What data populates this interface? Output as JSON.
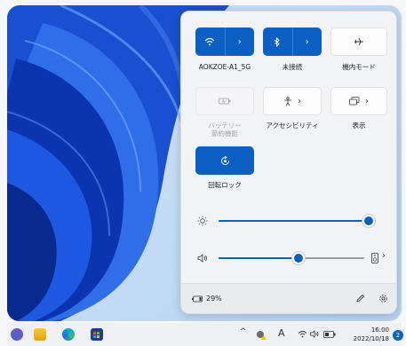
{
  "quick_settings": {
    "tiles": {
      "wifi_label": "AOKZOE-A1_5G",
      "bluetooth_label": "未接続",
      "airplane_label": "機内モード",
      "battery_saver_label": "バッテリー\n節約機能",
      "accessibility_label": "アクセシビリティ",
      "display_label": "表示",
      "rotation_lock_label": "回転ロック"
    },
    "brightness_level": 0.98,
    "volume_level": 0.55,
    "battery_text": "29%"
  },
  "taskbar": {
    "tray_chevron": "^",
    "ime_indicator": "A",
    "time": "16:00",
    "date": "2022/10/18",
    "notification_count": "2"
  },
  "colors": {
    "accent": "#0c5fc2",
    "wallpaper": "#1a4fd0"
  },
  "icons": [
    "wifi-icon",
    "bluetooth-icon",
    "airplane-icon",
    "battery-saver-icon",
    "accessibility-icon",
    "display-icon",
    "rotation-lock-icon",
    "brightness-icon",
    "volume-icon",
    "audio-output-icon",
    "battery-icon",
    "edit-icon",
    "gear-icon",
    "start-icon",
    "file-explorer-icon",
    "edge-icon",
    "store-icon",
    "warning-icon",
    "network-icon",
    "speaker-icon",
    "battery-tray-icon"
  ]
}
